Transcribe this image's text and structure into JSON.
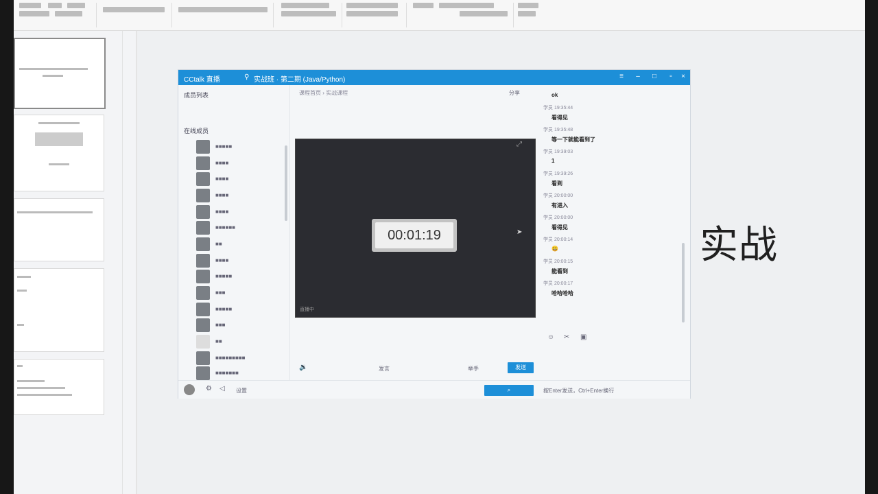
{
  "slide": {
    "main_text": "实战"
  },
  "chat_window": {
    "title": "CCtalk 直播",
    "tab_title": "实战班 · 第二期 (Java/Python)",
    "breadcrumb": "课程首页 › 实战课程",
    "share_label": "分享",
    "timer": "00:01:19",
    "video_label": "直播中",
    "send_label": "发送",
    "mic_label": "发言",
    "hand_label": "举手",
    "bottom_hint": "按Enter发送，Ctrl+Enter换行",
    "settings_label": "设置",
    "sidebar": {
      "header": "成员列表",
      "subheader": "在线成员"
    },
    "messages": [
      {
        "meta": "",
        "text": "ok"
      },
      {
        "meta": "学员 19:35:44",
        "text": "看得见"
      },
      {
        "meta": "学员 19:35:48",
        "text": "等一下就能看到了"
      },
      {
        "meta": "学员 19:39:03",
        "text": "1"
      },
      {
        "meta": "学员 19:39:26",
        "text": "看到"
      },
      {
        "meta": "学员 20:00:00",
        "text": "有进入"
      },
      {
        "meta": "学员 20:00:00",
        "text": "看得见"
      },
      {
        "meta": "学员 20:00:14",
        "text": "😃"
      },
      {
        "meta": "学员 20:00:15",
        "text": "能看到"
      },
      {
        "meta": "学员 20:00:17",
        "text": "哈哈哈哈"
      }
    ]
  }
}
